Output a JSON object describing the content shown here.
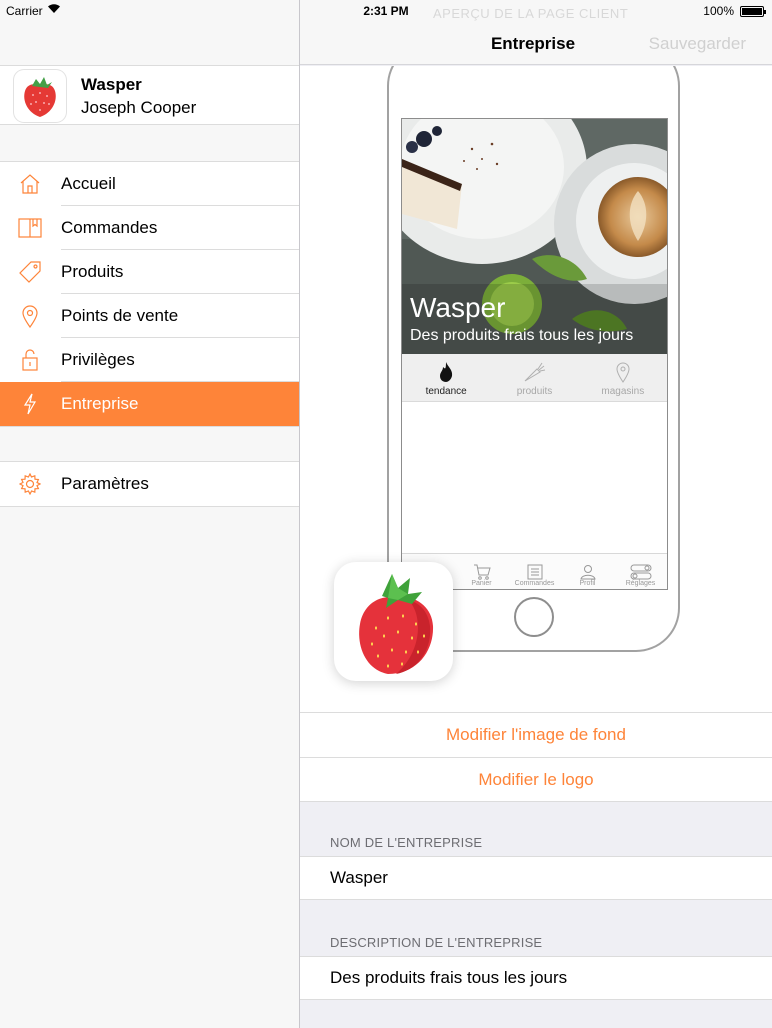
{
  "status_bar": {
    "carrier": "Carrier",
    "time": "2:31 PM",
    "battery": "100%"
  },
  "sidebar": {
    "company_name": "Wasper",
    "user_name": "Joseph Cooper",
    "items": [
      {
        "label": "Accueil",
        "icon": "home-icon"
      },
      {
        "label": "Commandes",
        "icon": "orders-icon"
      },
      {
        "label": "Produits",
        "icon": "tag-icon"
      },
      {
        "label": "Points de vente",
        "icon": "location-pin-icon"
      },
      {
        "label": "Privilèges",
        "icon": "lock-icon"
      },
      {
        "label": "Entreprise",
        "icon": "lightning-icon",
        "active": true
      }
    ],
    "settings": {
      "label": "Paramètres",
      "icon": "gear-icon"
    }
  },
  "nav": {
    "ghost_title": "APERÇU DE LA PAGE CLIENT",
    "title": "Entreprise",
    "save_label": "Sauvegarder"
  },
  "preview": {
    "hero_title": "Wasper",
    "hero_subtitle": "Des produits frais tous les jours",
    "tabs": [
      {
        "label": "tendance",
        "icon": "flame-icon",
        "active": true
      },
      {
        "label": "produits",
        "icon": "carrot-icon"
      },
      {
        "label": "magasins",
        "icon": "location-pin-icon"
      }
    ],
    "bottom_tabs": [
      {
        "label": "",
        "icon": "search-icon"
      },
      {
        "label": "Panier",
        "icon": "cart-icon"
      },
      {
        "label": "Commandes",
        "icon": "list-icon"
      },
      {
        "label": "Profil",
        "icon": "profile-icon"
      },
      {
        "label": "Réglages",
        "icon": "toggle-icon"
      }
    ]
  },
  "actions": {
    "change_background": "Modifier l'image de fond",
    "change_logo": "Modifier le logo"
  },
  "company_name_section": {
    "header": "NOM DE L'ENTREPRISE",
    "value": "Wasper"
  },
  "company_description_section": {
    "header": "DESCRIPTION DE L'ENTREPRISE",
    "value": "Des produits frais tous les jours"
  },
  "colors": {
    "accent": "#fe8439",
    "background": "#efeff4"
  }
}
